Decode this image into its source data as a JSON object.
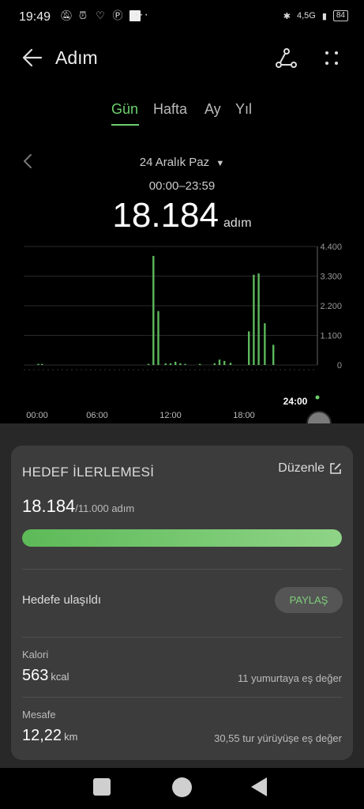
{
  "status_bar": {
    "time": "19:49",
    "more": "···",
    "network": "4,5G",
    "battery": "84"
  },
  "header": {
    "title": "Adım"
  },
  "tabs": [
    {
      "label": "Gün",
      "active": true
    },
    {
      "label": "Hafta",
      "active": false
    },
    {
      "label": "Ay",
      "active": false
    },
    {
      "label": "Yıl",
      "active": false
    }
  ],
  "date_nav": {
    "date": "24 Aralık Paz",
    "time_range": "00:00–23:59"
  },
  "summary": {
    "steps": "18.184",
    "unit": "adım"
  },
  "chart_data": {
    "type": "bar",
    "y_ticks": [
      "4.400",
      "3.300",
      "2.200",
      "1.100",
      "0"
    ],
    "x_ticks": [
      "00:00",
      "06:00",
      "12:00",
      "18:00"
    ],
    "end_label": "24:00",
    "ylim": [
      0,
      4400
    ],
    "x_unit": "hour",
    "bar_color": "#5cb85c",
    "values": [
      {
        "h": 1.2,
        "v": 40
      },
      {
        "h": 1.5,
        "v": 40
      },
      {
        "h": 10.2,
        "v": 40
      },
      {
        "h": 10.6,
        "v": 4050
      },
      {
        "h": 11.0,
        "v": 2000
      },
      {
        "h": 11.6,
        "v": 60
      },
      {
        "h": 12.0,
        "v": 60
      },
      {
        "h": 12.4,
        "v": 120
      },
      {
        "h": 12.8,
        "v": 60
      },
      {
        "h": 13.2,
        "v": 40
      },
      {
        "h": 14.4,
        "v": 40
      },
      {
        "h": 15.6,
        "v": 60
      },
      {
        "h": 16.0,
        "v": 200
      },
      {
        "h": 16.4,
        "v": 150
      },
      {
        "h": 16.9,
        "v": 80
      },
      {
        "h": 18.4,
        "v": 1250
      },
      {
        "h": 18.8,
        "v": 3350
      },
      {
        "h": 19.2,
        "v": 3400
      },
      {
        "h": 19.7,
        "v": 1550
      },
      {
        "h": 20.4,
        "v": 750
      }
    ]
  },
  "goal": {
    "title": "HEDEF İLERLEMESİ",
    "edit_label": "Düzenle",
    "current": "18.184",
    "target_text": "/11.000 adım",
    "progress": 1.0,
    "reached_label": "Hedefe ulaşıldı",
    "share_label": "PAYLAŞ"
  },
  "stats": [
    {
      "label": "Kalori",
      "value": "563",
      "unit": "kcal",
      "equivalent": "11 yumurtaya eş değer"
    },
    {
      "label": "Mesafe",
      "value": "12,22",
      "unit": "km",
      "equivalent": "30,55 tur yürüyüşe eş değer"
    }
  ],
  "colors": {
    "accent": "#6cd06c",
    "background": "#000000",
    "card": "#3c3c3c"
  }
}
